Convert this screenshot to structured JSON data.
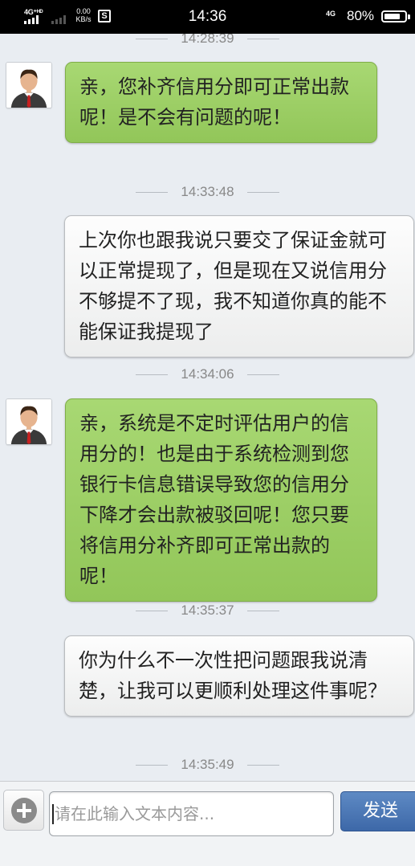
{
  "status_bar": {
    "network_left": "4G⁺ᴴᴰ",
    "speed_value": "0.00",
    "speed_unit": "KB/s",
    "app_icon": "S",
    "time": "14:36",
    "network_right": "4G",
    "battery_percent": "80%",
    "battery_level": 0.8
  },
  "chat": {
    "timestamps": [
      "14:28:39",
      "14:33:48",
      "14:34:06",
      "14:35:37",
      "14:35:49"
    ],
    "messages": [
      {
        "side": "left",
        "text": "亲，您补齐信用分即可正常出款呢！是不会有问题的呢！"
      },
      {
        "side": "right",
        "text": "上次你也跟我说只要交了保证金就可以正常提现了，但是现在又说信用分不够提不了现，我不知道你真的能不能保证我提现了"
      },
      {
        "side": "left",
        "text": "亲，系统是不定时评估用户的信用分的！也是由于系统检测到您银行卡信息错误导致您的信用分下降才会出款被驳回呢！您只要将信用分补齐即可正常出款的呢！"
      },
      {
        "side": "right",
        "text": "你为什么不一次性把问题跟我说清楚，让我可以更顺利处理这件事呢？"
      }
    ]
  },
  "input_bar": {
    "placeholder": "请在此输入文本内容...",
    "send_label": "发送",
    "plus_icon": "add-circle-icon"
  },
  "colors": {
    "incoming_bubble": "#9ccf65",
    "outgoing_bubble": "#f6f6f6",
    "background": "#e9edf2",
    "send_button": "#4a75b3"
  }
}
